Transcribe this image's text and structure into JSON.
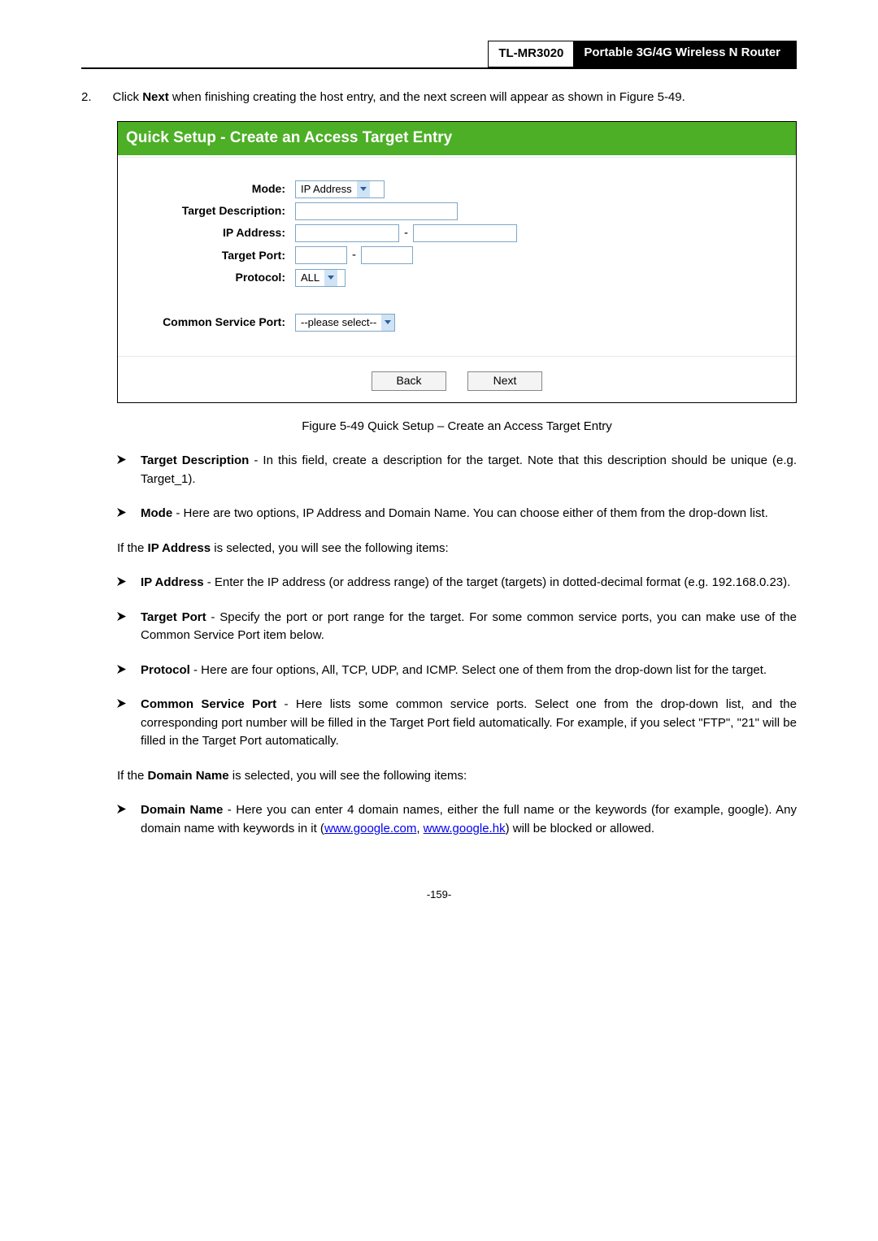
{
  "header": {
    "model": "TL-MR3020",
    "title": "Portable 3G/4G Wireless N Router"
  },
  "step": {
    "num": "2.",
    "pre": "Click ",
    "bold": "Next",
    "post": " when finishing creating the host entry, and the next screen will appear as shown in Figure 5-49."
  },
  "figure": {
    "title": "Quick Setup - Create an Access Target Entry",
    "labels": {
      "mode": "Mode:",
      "target_desc": "Target Description:",
      "ip": "IP Address:",
      "port": "Target Port:",
      "protocol": "Protocol:",
      "common": "Common Service Port:"
    },
    "values": {
      "mode": "IP Address",
      "protocol": "ALL",
      "common": "--please select--",
      "dash": "-"
    },
    "buttons": {
      "back": "Back",
      "next": "Next"
    }
  },
  "caption": "Figure 5-49    Quick Setup – Create an Access Target Entry",
  "b1": {
    "bold": "Target Description",
    "rest": " - In this field, create a description for the target. Note that this description should be unique (e.g. Target_1)."
  },
  "b2": {
    "bold": "Mode",
    "rest": " - Here are two options, IP Address and Domain Name. You can choose either of them from the drop-down list."
  },
  "p_ip": {
    "pre": "If the ",
    "bold": "IP Address",
    "post": " is selected, you will see the following items:"
  },
  "b3": {
    "bold": "IP Address",
    "rest": " - Enter the IP address (or address range) of the target (targets) in dotted-decimal format (e.g. 192.168.0.23)."
  },
  "b4": {
    "bold": "Target Port",
    "rest": " - Specify the port or port range for the target. For some common service ports, you can make use of the Common Service Port item below."
  },
  "b5": {
    "bold": "Protocol",
    "rest": " - Here are four options, All, TCP, UDP, and ICMP. Select one of them from the drop-down list for the target."
  },
  "b6": {
    "bold": "Common Service Port",
    "rest": " - Here lists some common service ports. Select one from the drop-down list, and the corresponding port number will be filled in the Target Port field automatically. For example, if you select \"FTP\", \"21\" will be filled in the Target Port automatically."
  },
  "p_dn": {
    "pre": "If the ",
    "bold": "Domain Name",
    "post": " is selected, you will see the following items:"
  },
  "b7": {
    "bold": "Domain Name",
    "pre_link": " - Here you can enter 4 domain names, either the full name or the keywords (for example, google). Any domain name with keywords in it (",
    "link1": "www.google.com",
    "sep": ", ",
    "link2": "www.google.hk",
    "post_link": ") will be blocked or allowed."
  },
  "page_num": "-159-"
}
